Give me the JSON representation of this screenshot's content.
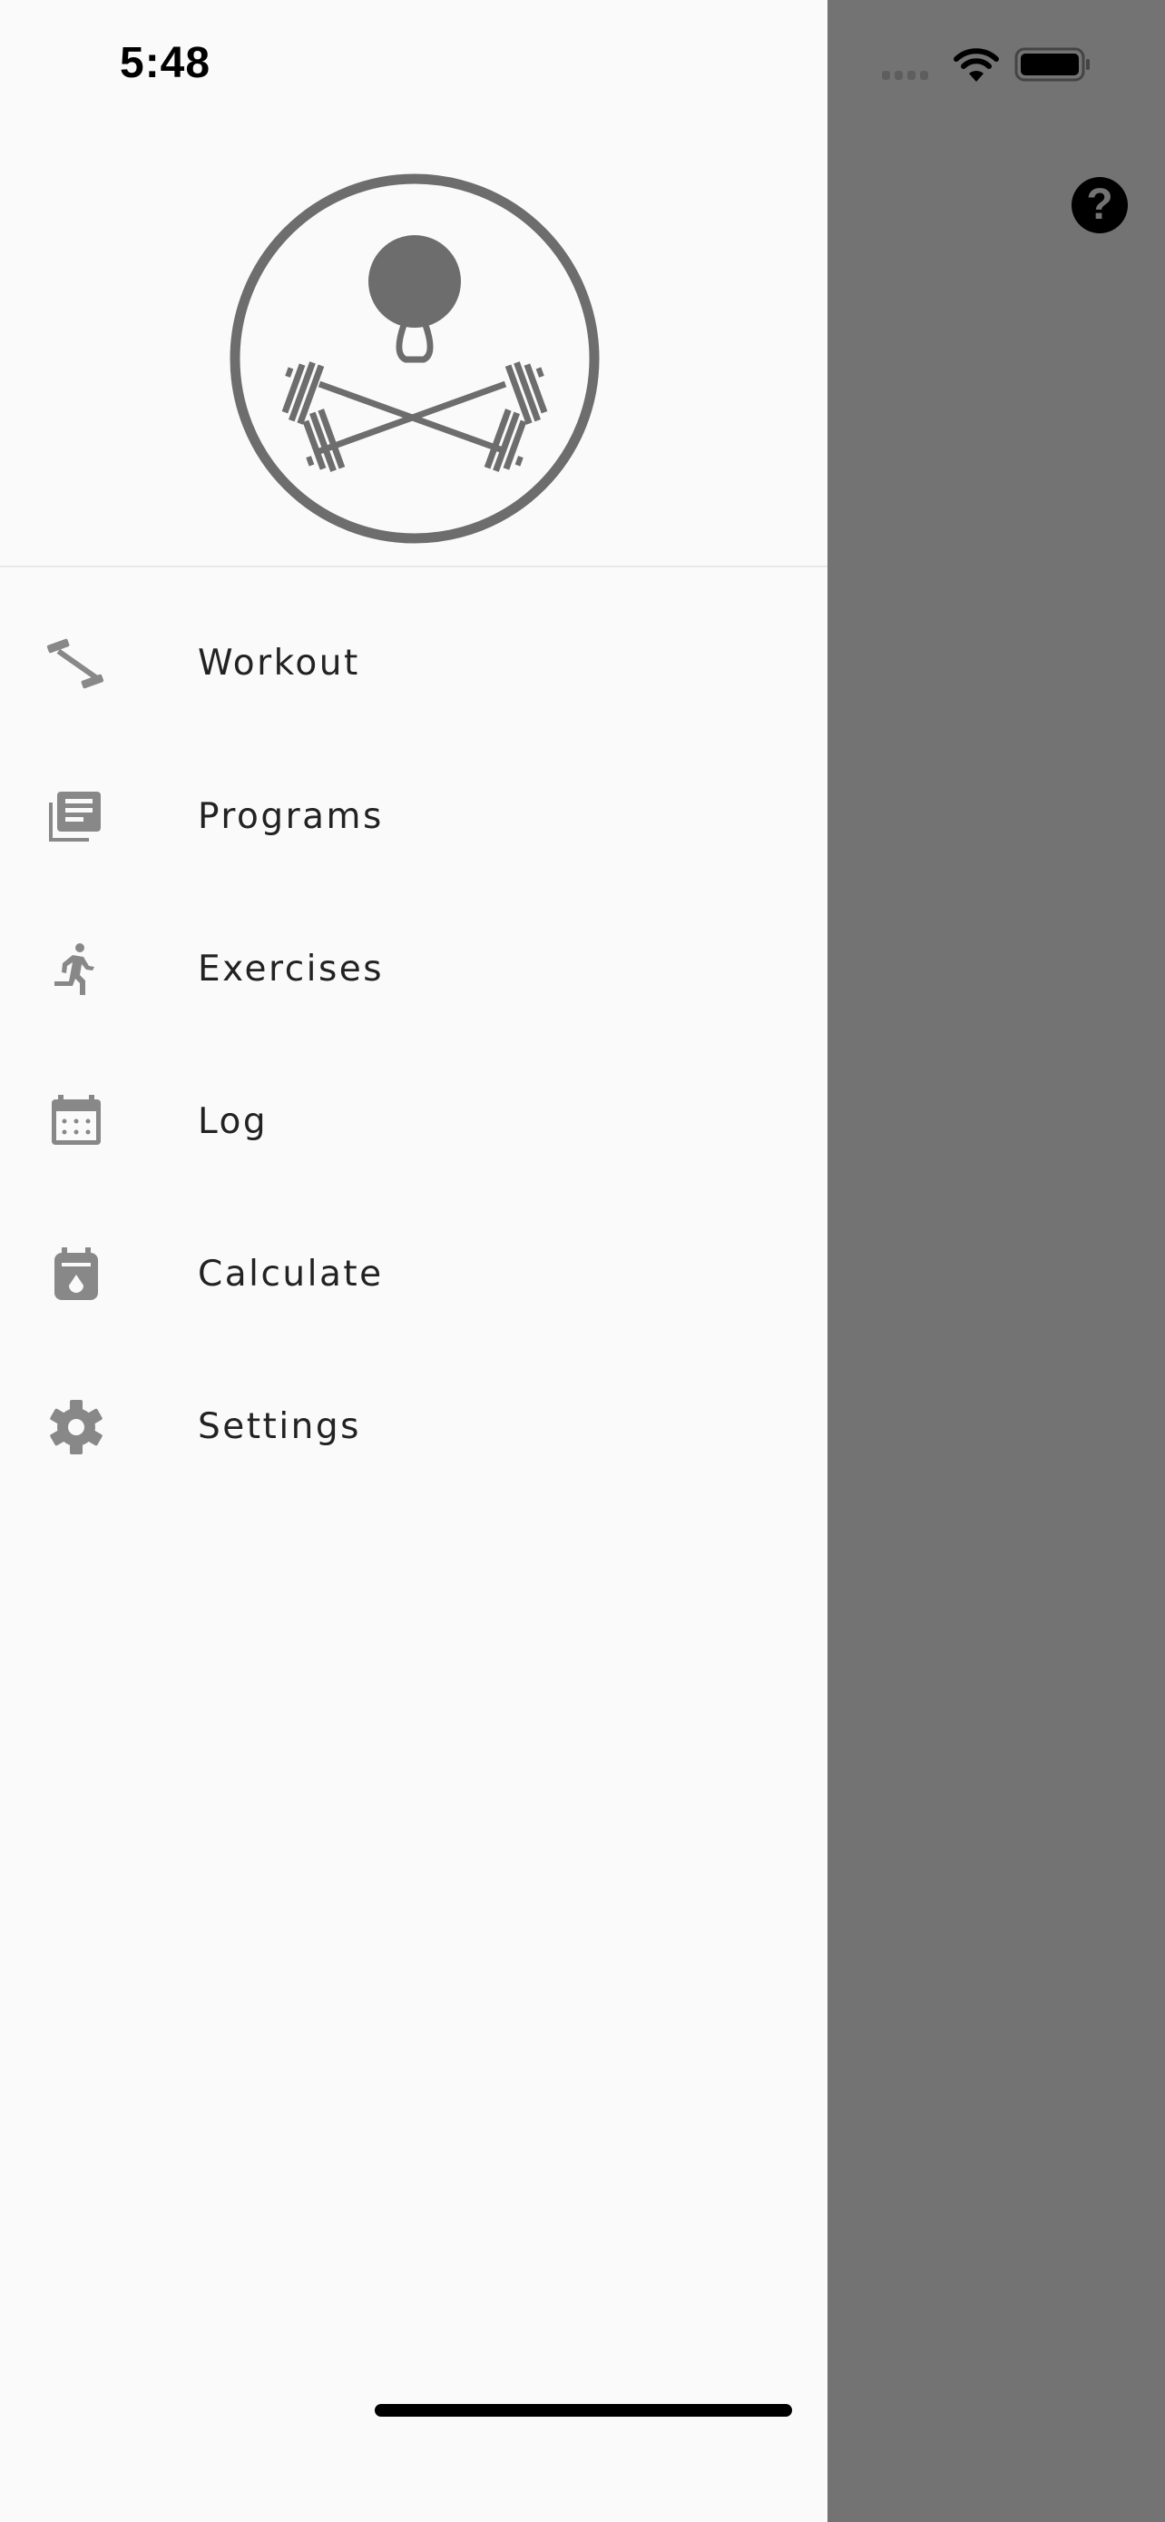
{
  "status_bar": {
    "time": "5:48",
    "signal_icon": "cellular-signal-icon",
    "wifi_icon": "wifi-icon",
    "battery_icon": "battery-icon"
  },
  "drawer": {
    "logo": "barbell-kettlebell-logo",
    "items": [
      {
        "label": "Workout",
        "icon": "barbell-icon"
      },
      {
        "label": "Programs",
        "icon": "library-books-icon"
      },
      {
        "label": "Exercises",
        "icon": "running-person-icon"
      },
      {
        "label": "Log",
        "icon": "calendar-icon"
      },
      {
        "label": "Calculate",
        "icon": "calculator-icon"
      },
      {
        "label": "Settings",
        "icon": "gear-icon"
      }
    ]
  },
  "background": {
    "help_label": "?",
    "help_icon": "help-icon"
  },
  "colors": {
    "drawer_bg": "#fafafa",
    "scrim": "#737373",
    "icon": "#888888",
    "logo": "#6d6d6d",
    "text": "#222222"
  }
}
